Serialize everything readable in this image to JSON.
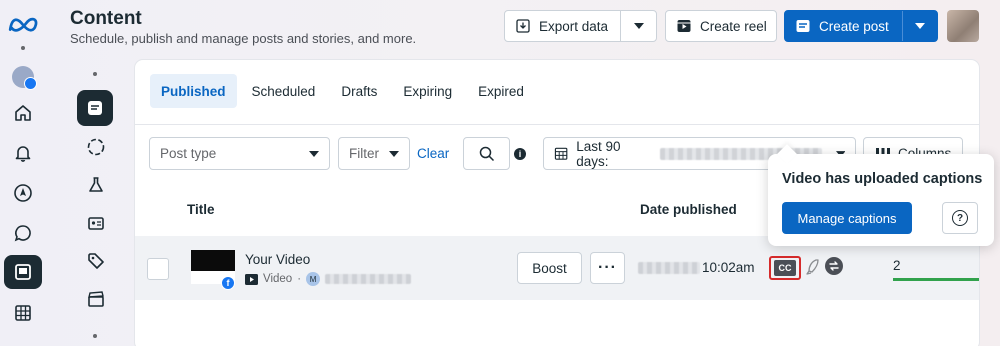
{
  "header": {
    "title": "Content",
    "subtitle": "Schedule, publish and manage posts and stories, and more.",
    "export_label": "Export data",
    "create_reel_label": "Create reel",
    "create_post_label": "Create post"
  },
  "tabs": [
    {
      "label": "Published",
      "active": true
    },
    {
      "label": "Scheduled"
    },
    {
      "label": "Drafts"
    },
    {
      "label": "Expiring"
    },
    {
      "label": "Expired"
    }
  ],
  "filters": {
    "post_type_placeholder": "Post type",
    "filter_label": "Filter",
    "clear_label": "Clear",
    "info_glyph": "i",
    "date_range_label": "Last 90 days:",
    "columns_label": "Columns"
  },
  "table": {
    "headers": {
      "title": "Title",
      "date_published": "Date published"
    },
    "rows": [
      {
        "title": "Your Video",
        "type": "Video",
        "separator": "·",
        "avatar_letter": "M",
        "thumb_badge": "f",
        "boost_label": "Boost",
        "more_label": "···",
        "time": "10:02am",
        "cc_label": "CC",
        "metric": "2"
      }
    ]
  },
  "popover": {
    "title": "Video has uploaded captions",
    "manage_label": "Manage captions",
    "help_glyph": "?"
  },
  "colors": {
    "accent": "#0a66c2",
    "highlight_border": "#d62b2b",
    "metric_bar": "#31a24c"
  }
}
